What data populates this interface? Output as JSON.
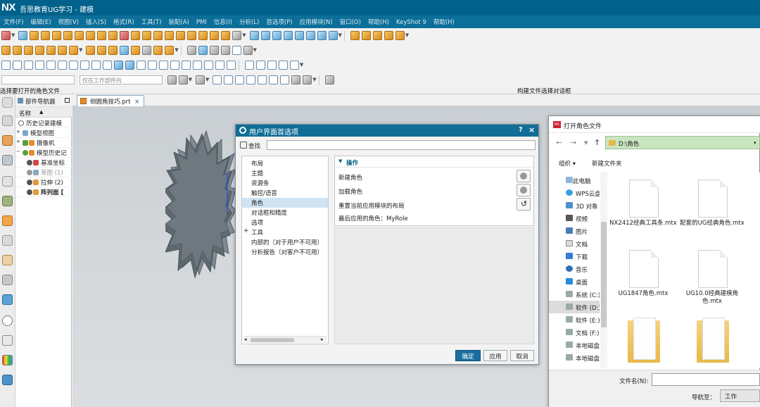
{
  "app": {
    "logo": "NX",
    "title": "吾思教育UG学习 - 建模"
  },
  "menu": [
    "文件(F)",
    "编辑(E)",
    "视图(V)",
    "插入(S)",
    "格式(R)",
    "工具(T)",
    "装配(A)",
    "PMI",
    "信息(I)",
    "分析(L)",
    "首选项(P)",
    "应用模块(N)",
    "窗口(O)",
    "帮助(H)",
    "KeyShot 9",
    "帮助(H)"
  ],
  "toolbar": {
    "filter_placeholder": "仅在工作部件内"
  },
  "cue": {
    "left": "选择要打开的角色文件",
    "right": "构建文件选择对话框"
  },
  "navigator": {
    "title": "部件导航器",
    "column_name": "名称",
    "rows": [
      {
        "label": "历史记录建模"
      },
      {
        "label": "模型视图"
      },
      {
        "label": "摄像机"
      },
      {
        "label": "模型历史记"
      },
      {
        "label": "基准坐标"
      },
      {
        "label": "草图 (1)"
      },
      {
        "label": "拉伸 (2)"
      },
      {
        "label": "阵列面 ["
      }
    ]
  },
  "document_tab": {
    "label": "倒圆角技巧.prt",
    "close": "×"
  },
  "preferences_dialog": {
    "title": "用户界面首选项",
    "help": "?",
    "close": "×",
    "find_label": "查找",
    "tree": [
      {
        "label": "布局"
      },
      {
        "label": "主题"
      },
      {
        "label": "资源条"
      },
      {
        "label": "触控/语音"
      },
      {
        "label": "角色",
        "selected": true
      },
      {
        "label": "对话框和精度"
      },
      {
        "label": "选项"
      },
      {
        "label": "工具"
      },
      {
        "label": "内部的（对于用户不可用）"
      },
      {
        "label": "分析报告（对客户不可用）"
      }
    ],
    "section_title": "操作",
    "actions": {
      "new_role": "新建角色",
      "load_role": "加载角色",
      "reset_layout": "重置当前应用模块的布局",
      "last_role": "最后应用的角色：MyRole"
    },
    "buttons": {
      "ok": "确定",
      "apply": "应用",
      "cancel": "取消"
    }
  },
  "open_dialog": {
    "title": "打开角色文件",
    "logo": "NX",
    "address": "D:\\角色",
    "organize": "组织 ▾",
    "new_folder": "新建文件夹",
    "sidebar": [
      {
        "label": "此电脑",
        "icon": "computer-icon"
      },
      {
        "label": "WPS云盘",
        "icon": "cloud-icon"
      },
      {
        "label": "3D 对象",
        "icon": "cube-icon"
      },
      {
        "label": "视频",
        "icon": "video-icon"
      },
      {
        "label": "图片",
        "icon": "picture-icon"
      },
      {
        "label": "文档",
        "icon": "document-icon"
      },
      {
        "label": "下载",
        "icon": "download-icon"
      },
      {
        "label": "音乐",
        "icon": "music-icon"
      },
      {
        "label": "桌面",
        "icon": "desktop-icon"
      },
      {
        "label": "系统 (C:)",
        "icon": "drive-icon"
      },
      {
        "label": "软件 (D:)",
        "icon": "drive-icon",
        "selected": true
      },
      {
        "label": "软件 (E:)",
        "icon": "drive-icon"
      },
      {
        "label": "文档 (F:)",
        "icon": "drive-icon"
      },
      {
        "label": "本地磁盘",
        "icon": "drive-icon"
      },
      {
        "label": "本地磁盘",
        "icon": "drive-icon"
      }
    ],
    "files": [
      {
        "name": "NX2412经典工具条.mtx",
        "type": "file"
      },
      {
        "name": "配套的UG经典角色.mtx",
        "type": "file"
      },
      {
        "name": "UG1847角色.mtx",
        "type": "file"
      },
      {
        "name": "UG10.0经典建模角色.mtx",
        "type": "file"
      },
      {
        "name": "",
        "type": "folder"
      },
      {
        "name": "",
        "type": "folder"
      }
    ],
    "filename_label": "文件名(N):",
    "navigate_label": "导航至：",
    "navigate_value": "工作"
  },
  "colors": {
    "title_bar": "#00618a",
    "menu_bar": "#0c6f99",
    "dialog_title": "#0f6d96",
    "address_bar": "#c9e6c1",
    "ok_button": "#1b6fa0"
  }
}
